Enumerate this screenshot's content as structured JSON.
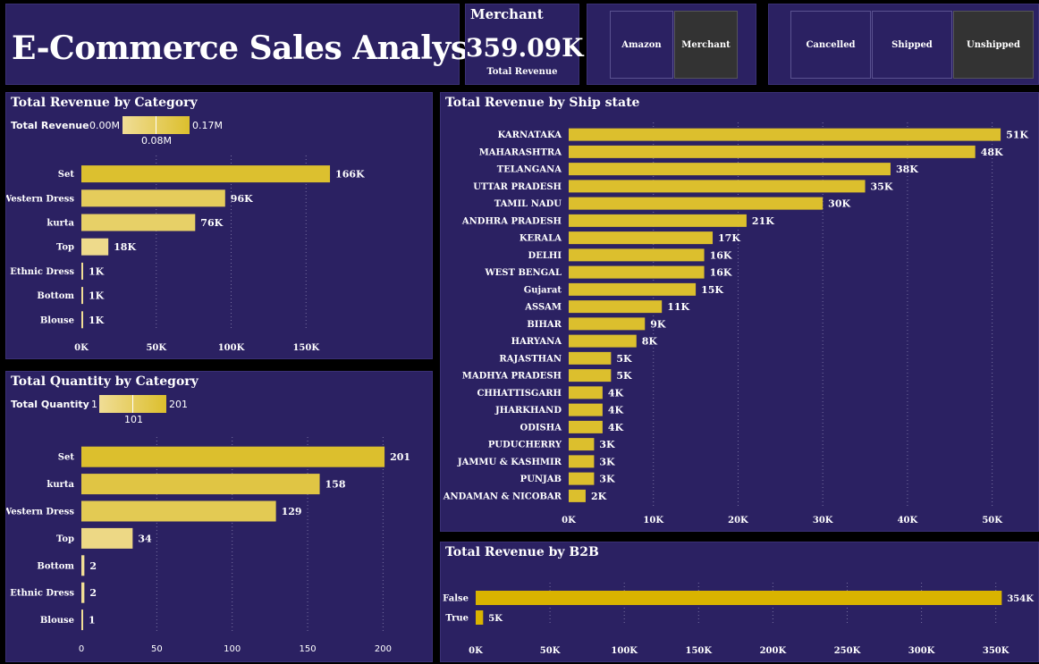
{
  "header": {
    "title": "E-Commerce Sales Analysis"
  },
  "card": {
    "label": "Merchant",
    "value": "359.09K",
    "caption": "Total Revenue"
  },
  "fulfilment_slicer": {
    "options": [
      {
        "label": "Amazon",
        "selected": false
      },
      {
        "label": "Merchant",
        "selected": true
      }
    ]
  },
  "courier_slicer": {
    "options": [
      {
        "label": "Cancelled",
        "selected": false
      },
      {
        "label": "Shipped",
        "selected": false
      },
      {
        "label": "Unshipped",
        "selected": true
      }
    ]
  },
  "colors": {
    "background": "#000000",
    "panel": "#2b2162",
    "bar_dark": "#dcbf2d",
    "bar_light": "#f0dd96",
    "b2b_bar": "#d9b300",
    "grid": "#8a84b0"
  },
  "revenue_by_category": {
    "title": "Total Revenue by Category",
    "legend": {
      "label": "Total Revenue",
      "min": "0.00M",
      "mid": "0.08M",
      "max": "0.17M"
    }
  },
  "quantity_by_category": {
    "title": "Total Quantity by Category",
    "legend": {
      "label": "Total Quantity",
      "min": "1",
      "mid": "101",
      "max": "201"
    }
  },
  "revenue_by_state": {
    "title": "Total Revenue by Ship state"
  },
  "revenue_by_b2b": {
    "title": "Total Revenue by B2B"
  },
  "chart_data": [
    {
      "id": "cat_rev",
      "type": "bar",
      "orientation": "horizontal",
      "title": "Total Revenue by Category",
      "categories": [
        "Set",
        "Western Dress",
        "kurta",
        "Top",
        "Ethnic Dress",
        "Bottom",
        "Blouse"
      ],
      "values": [
        166000,
        96000,
        76000,
        18000,
        1000,
        1000,
        1000
      ],
      "labels": [
        "166K",
        "96K",
        "76K",
        "18K",
        "1K",
        "1K",
        "1K"
      ],
      "xlim": [
        0,
        200000
      ],
      "ticks": [
        0,
        50000,
        100000,
        150000
      ],
      "tick_labels": [
        "0K",
        "50K",
        "100K",
        "150K"
      ],
      "color_scale": [
        0,
        170000
      ]
    },
    {
      "id": "cat_qty",
      "type": "bar",
      "orientation": "horizontal",
      "title": "Total Quantity by Category",
      "categories": [
        "Set",
        "kurta",
        "Western Dress",
        "Top",
        "Bottom",
        "Ethnic Dress",
        "Blouse"
      ],
      "values": [
        201,
        158,
        129,
        34,
        2,
        2,
        1
      ],
      "labels": [
        "201",
        "158",
        "129",
        "34",
        "2",
        "2",
        "1"
      ],
      "xlim": [
        0,
        230
      ],
      "ticks": [
        0,
        50,
        100,
        150,
        200
      ],
      "tick_labels": [
        "0",
        "50",
        "100",
        "150",
        "200"
      ],
      "color_scale": [
        1,
        201
      ]
    },
    {
      "id": "state_rev",
      "type": "bar",
      "orientation": "horizontal",
      "title": "Total Revenue by Ship state",
      "categories": [
        "KARNATAKA",
        "MAHARASHTRA",
        "TELANGANA",
        "UTTAR PRADESH",
        "TAMIL NADU",
        "ANDHRA PRADESH",
        "KERALA",
        "DELHI",
        "WEST BENGAL",
        "Gujarat",
        "ASSAM",
        "BIHAR",
        "HARYANA",
        "RAJASTHAN",
        "MADHYA PRADESH",
        "CHHATTISGARH",
        "JHARKHAND",
        "ODISHA",
        "PUDUCHERRY",
        "JAMMU & KASHMIR",
        "PUNJAB",
        "ANDAMAN & NICOBAR"
      ],
      "values": [
        51000,
        48000,
        38000,
        35000,
        30000,
        21000,
        17000,
        16000,
        16000,
        15000,
        11000,
        9000,
        8000,
        5000,
        5000,
        4000,
        4000,
        4000,
        3000,
        3000,
        3000,
        2000
      ],
      "labels": [
        "51K",
        "48K",
        "38K",
        "35K",
        "30K",
        "21K",
        "17K",
        "16K",
        "16K",
        "15K",
        "11K",
        "9K",
        "8K",
        "5K",
        "5K",
        "4K",
        "4K",
        "4K",
        "3K",
        "3K",
        "3K",
        "2K"
      ],
      "xlim": [
        0,
        55000
      ],
      "ticks": [
        0,
        10000,
        20000,
        30000,
        40000,
        50000
      ],
      "tick_labels": [
        "0K",
        "10K",
        "20K",
        "30K",
        "40K",
        "50K"
      ]
    },
    {
      "id": "b2b_rev",
      "type": "bar",
      "orientation": "horizontal",
      "title": "Total Revenue by B2B",
      "categories": [
        "False",
        "True"
      ],
      "values": [
        354000,
        5000
      ],
      "labels": [
        "354K",
        "5K"
      ],
      "xlim": [
        0,
        355000
      ],
      "ticks": [
        0,
        50000,
        100000,
        150000,
        200000,
        250000,
        300000,
        350000
      ],
      "tick_labels": [
        "0K",
        "50K",
        "100K",
        "150K",
        "200K",
        "250K",
        "300K",
        "350K"
      ]
    }
  ]
}
